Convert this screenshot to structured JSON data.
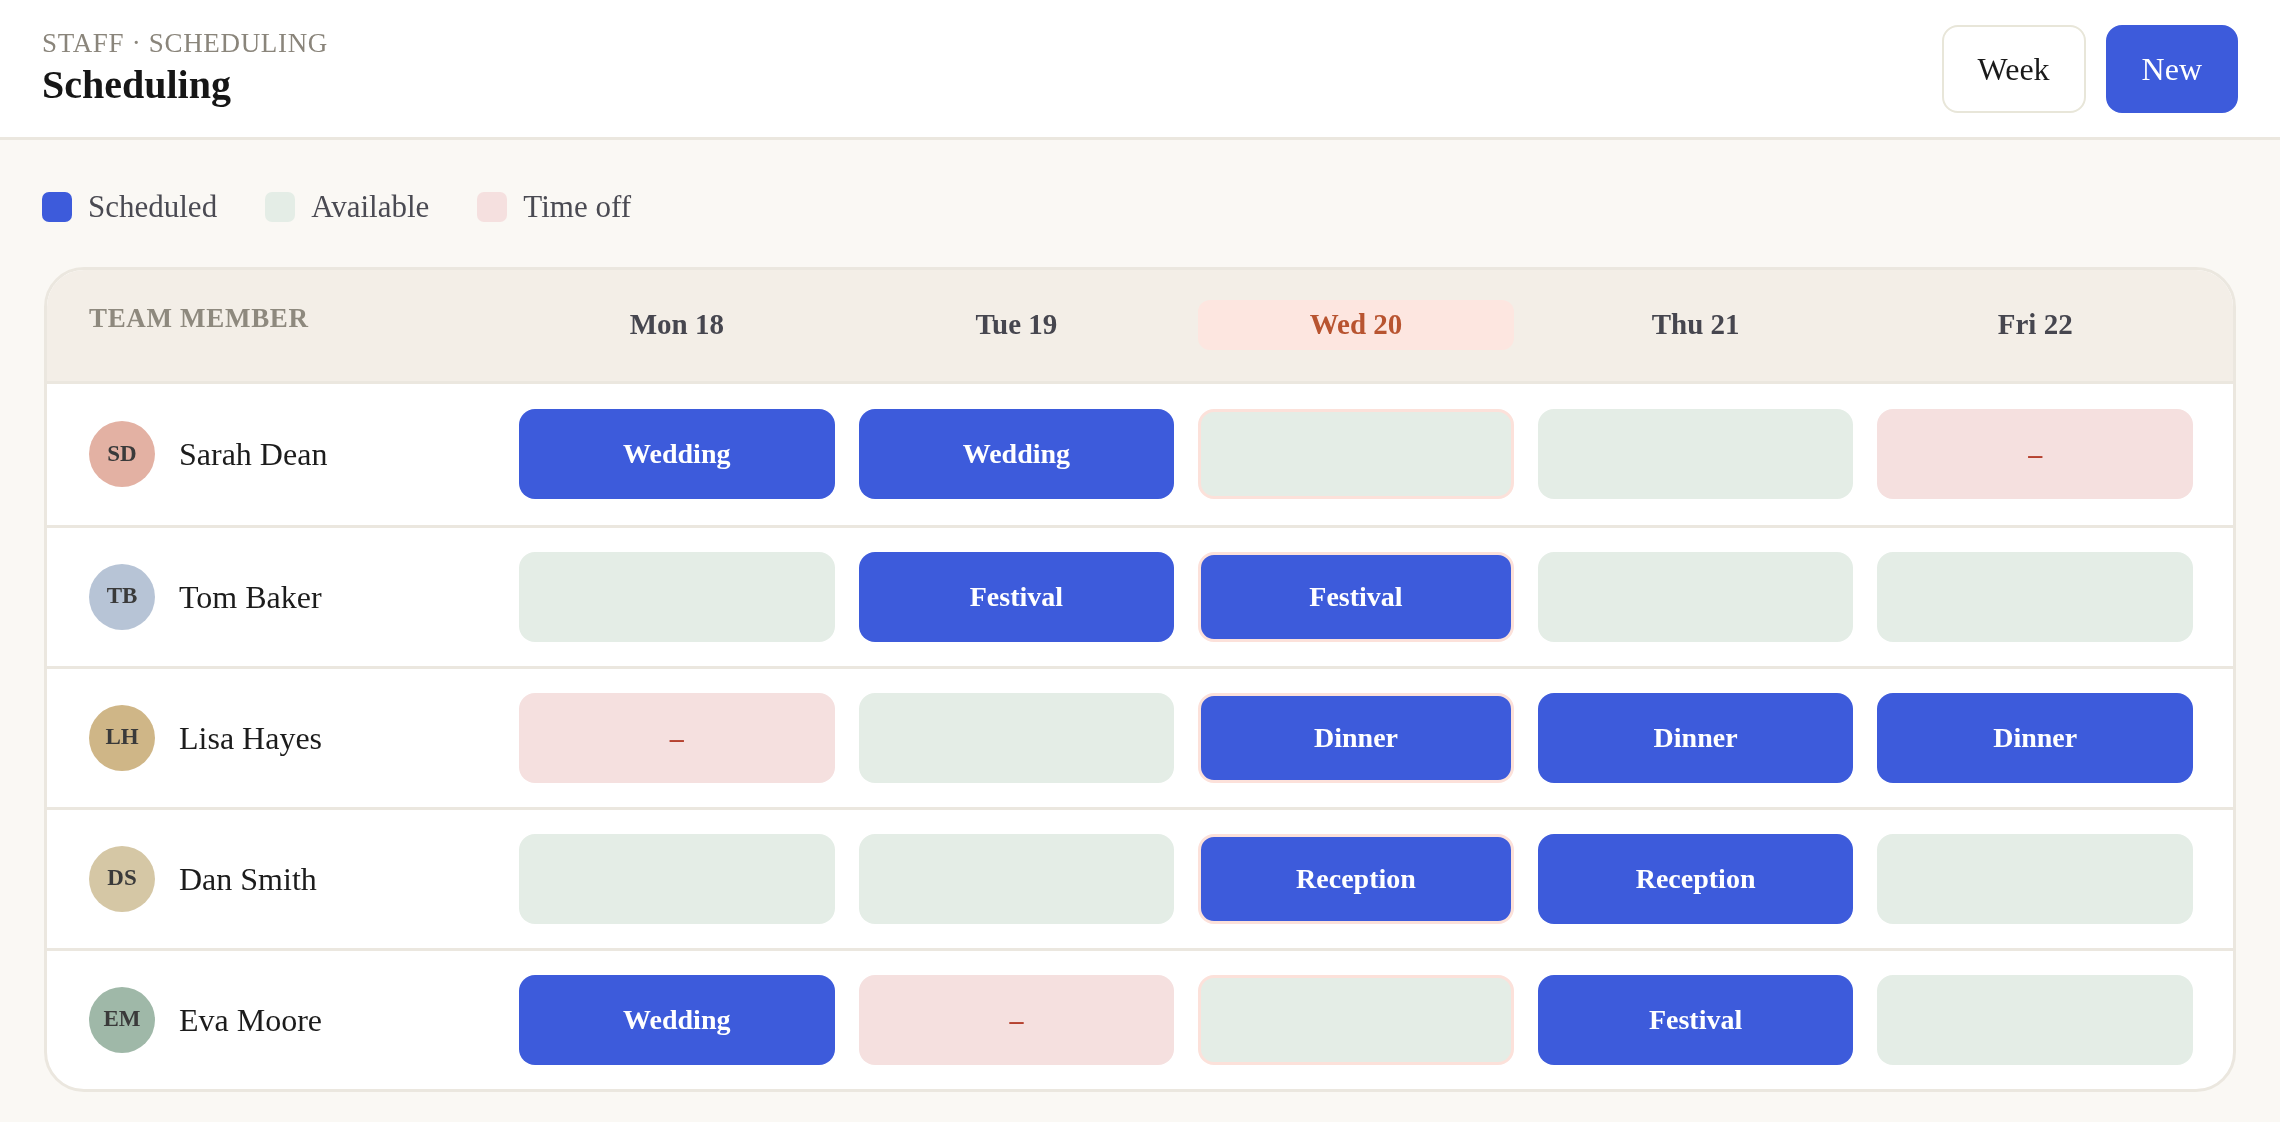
{
  "header": {
    "breadcrumb": "STAFF · SCHEDULING",
    "title": "Scheduling",
    "buttons": [
      {
        "label": "Week",
        "kind": "outline"
      },
      {
        "label": "New",
        "kind": "primary"
      }
    ]
  },
  "legend": [
    {
      "label": "Scheduled",
      "kind": "scheduled"
    },
    {
      "label": "Available",
      "kind": "available"
    },
    {
      "label": "Time off",
      "kind": "off"
    }
  ],
  "table": {
    "member_heading": "TEAM MEMBER",
    "days": [
      {
        "label": "Mon 18",
        "selected": false
      },
      {
        "label": "Tue 19",
        "selected": false
      },
      {
        "label": "Wed 20",
        "selected": true
      },
      {
        "label": "Thu 21",
        "selected": false
      },
      {
        "label": "Fri 22",
        "selected": false
      }
    ],
    "rows": [
      {
        "initials": "SD",
        "name": "Sarah Dean",
        "color": "#e3b1a3",
        "cells": [
          {
            "kind": "scheduled",
            "text": "Wedding"
          },
          {
            "kind": "scheduled",
            "text": "Wedding"
          },
          {
            "kind": "available"
          },
          {
            "kind": "available"
          },
          {
            "kind": "off",
            "text": "–"
          }
        ]
      },
      {
        "initials": "TB",
        "name": "Tom Baker",
        "color": "#b7c4d6",
        "cells": [
          {
            "kind": "available"
          },
          {
            "kind": "scheduled",
            "text": "Festival"
          },
          {
            "kind": "scheduled",
            "text": "Festival"
          },
          {
            "kind": "available"
          },
          {
            "kind": "available"
          }
        ]
      },
      {
        "initials": "LH",
        "name": "Lisa Hayes",
        "color": "#cfb687",
        "cells": [
          {
            "kind": "off",
            "text": "–"
          },
          {
            "kind": "available"
          },
          {
            "kind": "scheduled",
            "text": "Dinner"
          },
          {
            "kind": "scheduled",
            "text": "Dinner"
          },
          {
            "kind": "scheduled",
            "text": "Dinner"
          }
        ]
      },
      {
        "initials": "DS",
        "name": "Dan Smith",
        "color": "#d5c7a5",
        "cells": [
          {
            "kind": "available"
          },
          {
            "kind": "available"
          },
          {
            "kind": "scheduled",
            "text": "Reception"
          },
          {
            "kind": "scheduled",
            "text": "Reception"
          },
          {
            "kind": "available"
          }
        ]
      },
      {
        "initials": "EM",
        "name": "Eva Moore",
        "color": "#9fb8a8",
        "cells": [
          {
            "kind": "scheduled",
            "text": "Wedding"
          },
          {
            "kind": "off",
            "text": "–"
          },
          {
            "kind": "available"
          },
          {
            "kind": "scheduled",
            "text": "Festival"
          },
          {
            "kind": "available"
          }
        ]
      }
    ]
  }
}
